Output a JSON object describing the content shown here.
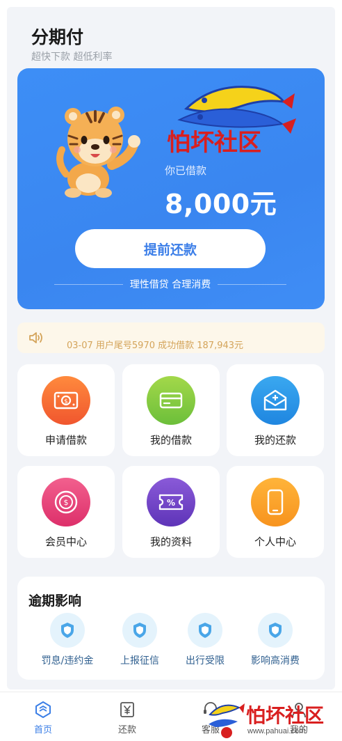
{
  "header": {
    "title": "分期付",
    "subtitle": "超快下款 超低利率"
  },
  "hero": {
    "loan_label": "你已借款",
    "loan_amount": "8,000元",
    "repay_button": "提前还款",
    "slogan": "理性借贷 合理消费",
    "watermark_logo": "怕坏社区"
  },
  "notice": {
    "icon": "speaker-icon",
    "text": "03-07 用户尾号5970 成功借款 187,943元"
  },
  "menu": [
    {
      "label": "申请借款",
      "icon": "money-icon",
      "color_from": "#ff8a3d",
      "color_to": "#f0562e"
    },
    {
      "label": "我的借款",
      "icon": "card-icon",
      "color_from": "#a3d84a",
      "color_to": "#6cbf3a"
    },
    {
      "label": "我的还款",
      "icon": "envelope-icon",
      "color_from": "#3aa8f0",
      "color_to": "#1f86e0"
    },
    {
      "label": "会员中心",
      "icon": "coin-icon",
      "color_from": "#f2608e",
      "color_to": "#dd2f6a"
    },
    {
      "label": "我的资料",
      "icon": "ticket-icon",
      "color_from": "#8a5ad8",
      "color_to": "#5e34b8"
    },
    {
      "label": "个人中心",
      "icon": "phone-icon",
      "color_from": "#ffb43a",
      "color_to": "#f7931e"
    }
  ],
  "overdue": {
    "title": "逾期影响",
    "items": [
      {
        "label": "罚息/违约金",
        "icon": "shield-icon"
      },
      {
        "label": "上报征信",
        "icon": "shield-icon"
      },
      {
        "label": "出行受限",
        "icon": "shield-icon"
      },
      {
        "label": "影响高消费",
        "icon": "shield-icon"
      }
    ]
  },
  "tabbar": {
    "items": [
      {
        "label": "首页",
        "icon": "home-icon",
        "active": true
      },
      {
        "label": "还款",
        "icon": "yen-icon",
        "active": false
      },
      {
        "label": "客服",
        "icon": "service-icon",
        "active": false
      },
      {
        "label": "我的",
        "icon": "user-icon",
        "active": false
      }
    ]
  },
  "corner_watermark": {
    "text": "怕坏社区",
    "url": "www.pahuai.com"
  },
  "colors": {
    "accent": "#3a86f0",
    "button_text": "#3b7ee8",
    "notice_text": "#d4a45a"
  }
}
